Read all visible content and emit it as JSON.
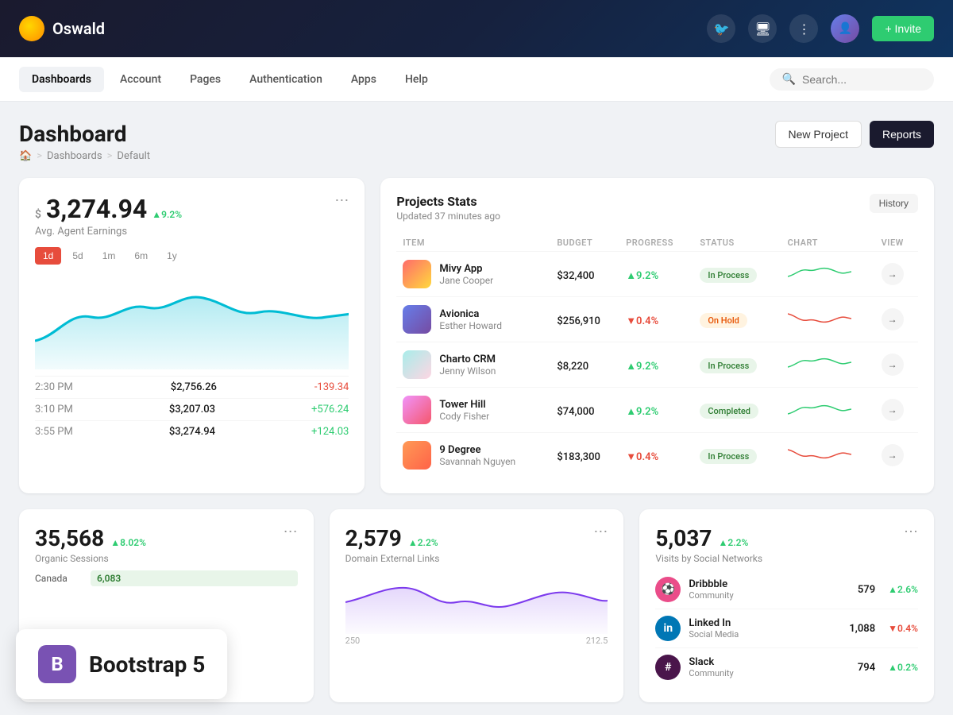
{
  "topbar": {
    "logo_text": "Oswald",
    "invite_label": "+ Invite"
  },
  "nav": {
    "items": [
      {
        "label": "Dashboards",
        "active": true
      },
      {
        "label": "Account",
        "active": false
      },
      {
        "label": "Pages",
        "active": false
      },
      {
        "label": "Authentication",
        "active": false
      },
      {
        "label": "Apps",
        "active": false
      },
      {
        "label": "Help",
        "active": false
      }
    ],
    "search_placeholder": "Search..."
  },
  "page_header": {
    "title": "Dashboard",
    "breadcrumb": [
      "🏠",
      "Dashboards",
      "Default"
    ],
    "btn_new_project": "New Project",
    "btn_reports": "Reports"
  },
  "earnings_card": {
    "currency_symbol": "$",
    "amount": "3,274.94",
    "badge": "▲9.2%",
    "subtitle": "Avg. Agent Earnings",
    "time_filters": [
      "1d",
      "5d",
      "1m",
      "6m",
      "1y"
    ],
    "active_filter": "1d",
    "stats": [
      {
        "time": "2:30 PM",
        "value": "$2,756.26",
        "change": "-139.34",
        "pos": false
      },
      {
        "time": "3:10 PM",
        "value": "$3,207.03",
        "change": "+576.24",
        "pos": true
      },
      {
        "time": "3:55 PM",
        "value": "$3,274.94",
        "change": "+124.03",
        "pos": true
      }
    ]
  },
  "projects_card": {
    "title": "Projects Stats",
    "subtitle": "Updated 37 minutes ago",
    "history_btn": "History",
    "columns": [
      "ITEM",
      "BUDGET",
      "PROGRESS",
      "STATUS",
      "CHART",
      "VIEW"
    ],
    "rows": [
      {
        "name": "Mivy App",
        "user": "Jane Cooper",
        "budget": "$32,400",
        "progress": "▲9.2%",
        "progress_pos": true,
        "status": "In Process",
        "status_type": "inprocess",
        "color": "#ff6b6b"
      },
      {
        "name": "Avionica",
        "user": "Esther Howard",
        "budget": "$256,910",
        "progress": "▼0.4%",
        "progress_pos": false,
        "status": "On Hold",
        "status_type": "onhold",
        "color": "#e74c3c"
      },
      {
        "name": "Charto CRM",
        "user": "Jenny Wilson",
        "budget": "$8,220",
        "progress": "▲9.2%",
        "progress_pos": true,
        "status": "In Process",
        "status_type": "inprocess",
        "color": "#2ecc71"
      },
      {
        "name": "Tower Hill",
        "user": "Cody Fisher",
        "budget": "$74,000",
        "progress": "▲9.2%",
        "progress_pos": true,
        "status": "Completed",
        "status_type": "completed",
        "color": "#2ecc71"
      },
      {
        "name": "9 Degree",
        "user": "Savannah Nguyen",
        "budget": "$183,300",
        "progress": "▼0.4%",
        "progress_pos": false,
        "status": "In Process",
        "status_type": "inprocess",
        "color": "#e74c3c"
      }
    ]
  },
  "organic_card": {
    "number": "35,568",
    "badge": "▲8.02%",
    "label": "Organic Sessions",
    "canada_label": "Canada",
    "canada_value": "6,083"
  },
  "domain_card": {
    "number": "2,579",
    "badge": "▲2.2%",
    "label": "Domain External Links",
    "chart_max": "250",
    "chart_mid": "212.5"
  },
  "social_card": {
    "number": "5,037",
    "badge": "▲2.2%",
    "label": "Visits by Social Networks",
    "items": [
      {
        "name": "Dribbble",
        "type": "Community",
        "count": "579",
        "badge": "▲2.6%",
        "badge_pos": true,
        "color": "#ea4c89"
      },
      {
        "name": "Linked In",
        "type": "Social Media",
        "count": "1,088",
        "badge": "▼0.4%",
        "badge_pos": false,
        "color": "#0077b5"
      },
      {
        "name": "Slack",
        "type": "Community",
        "count": "794",
        "badge": "▲0.2%",
        "badge_pos": true,
        "color": "#4a154b"
      }
    ]
  },
  "bootstrap_overlay": {
    "icon_text": "B",
    "text": "Bootstrap 5"
  }
}
